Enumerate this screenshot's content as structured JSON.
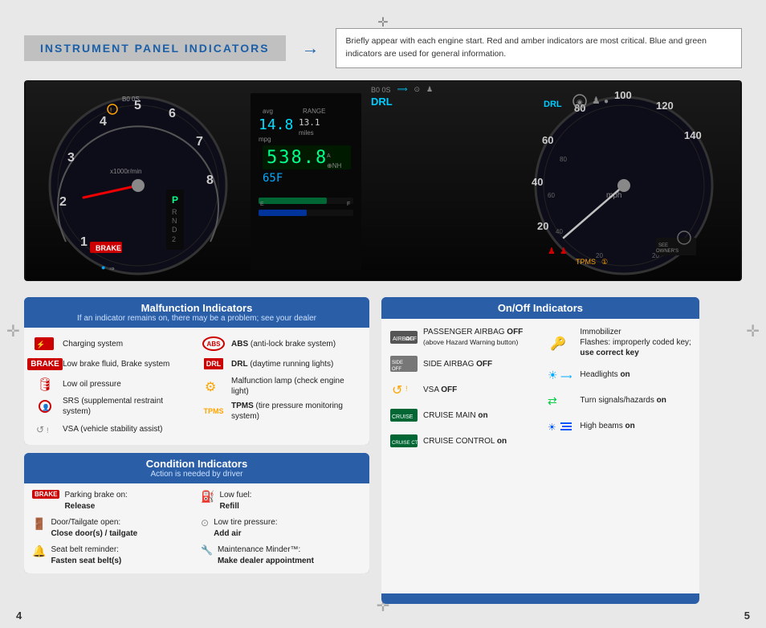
{
  "page": {
    "title": "INSTRUMENT PANEL INDICATORS",
    "page_left": "4",
    "page_right": "5",
    "description": "Briefly appear with each engine start. Red and amber indicators are most critical.\nBlue and green indicators are used for general information."
  },
  "malfunction": {
    "header": "Malfunction Indicators",
    "subheader": "If an indicator remains on, there may be a problem; see your dealer",
    "items_left": [
      {
        "label": "Charging system",
        "icon_type": "charging"
      },
      {
        "label": "Low brake fluid, Brake system",
        "icon_type": "brake"
      },
      {
        "label": "Low oil pressure",
        "icon_type": "oil"
      },
      {
        "label": "SRS (supplemental restraint system)",
        "icon_type": "srs"
      },
      {
        "label": "VSA (vehicle stability assist)",
        "icon_type": "vsa"
      }
    ],
    "items_right": [
      {
        "label": "ABS (anti-lock brake system)",
        "icon_type": "abs"
      },
      {
        "label": "DRL (daytime running lights)",
        "icon_type": "drl"
      },
      {
        "label": "Malfunction lamp (check engine light)",
        "icon_type": "malfunction"
      },
      {
        "label": "TPMS (tire pressure monitoring system)",
        "icon_type": "tpms"
      }
    ]
  },
  "condition": {
    "header": "Condition Indicators",
    "subheader": "Action is needed by driver",
    "items_left": [
      {
        "label_top": "Parking brake on:",
        "label_bold": "Release",
        "icon_type": "brake"
      },
      {
        "label_top": "Door/Tailgate open:",
        "label_bold": "Close door(s) / tailgate",
        "icon_type": "door"
      },
      {
        "label_top": "Seat belt reminder:",
        "label_bold": "Fasten seat belt(s)",
        "icon_type": "seatbelt"
      }
    ],
    "items_right": [
      {
        "label_top": "Low fuel:",
        "label_bold": "Refill",
        "icon_type": "fuel"
      },
      {
        "label_top": "Low tire pressure:",
        "label_bold": "Add air",
        "icon_type": "tire"
      },
      {
        "label_top": "Maintenance Minder™:",
        "label_bold": "Make dealer appointment",
        "icon_type": "wrench"
      }
    ]
  },
  "onoff": {
    "header": "On/Off Indicators",
    "items_left": [
      {
        "label": "PASSENGER AIRBAG OFF\n(above Hazard Warning button)",
        "icon_type": "airbag-off"
      },
      {
        "label": "SIDE AIRBAG OFF",
        "icon_type": "side-airbag"
      },
      {
        "label": "VSA OFF",
        "icon_type": "vsa-off"
      },
      {
        "label": "CRUISE MAIN on",
        "icon_type": "cruise-main"
      },
      {
        "label": "CRUISE CONTROL on",
        "icon_type": "cruise-control"
      }
    ],
    "items_right": [
      {
        "label": "Immobilizer\nFlashes: improperly coded key;\nuse correct key",
        "icon_type": "immobilizer"
      },
      {
        "label": "Headlights on",
        "icon_type": "headlights"
      },
      {
        "label": "Turn signals/hazards on",
        "icon_type": "turn-signals"
      },
      {
        "label": "High beams on",
        "icon_type": "high-beams"
      }
    ]
  }
}
